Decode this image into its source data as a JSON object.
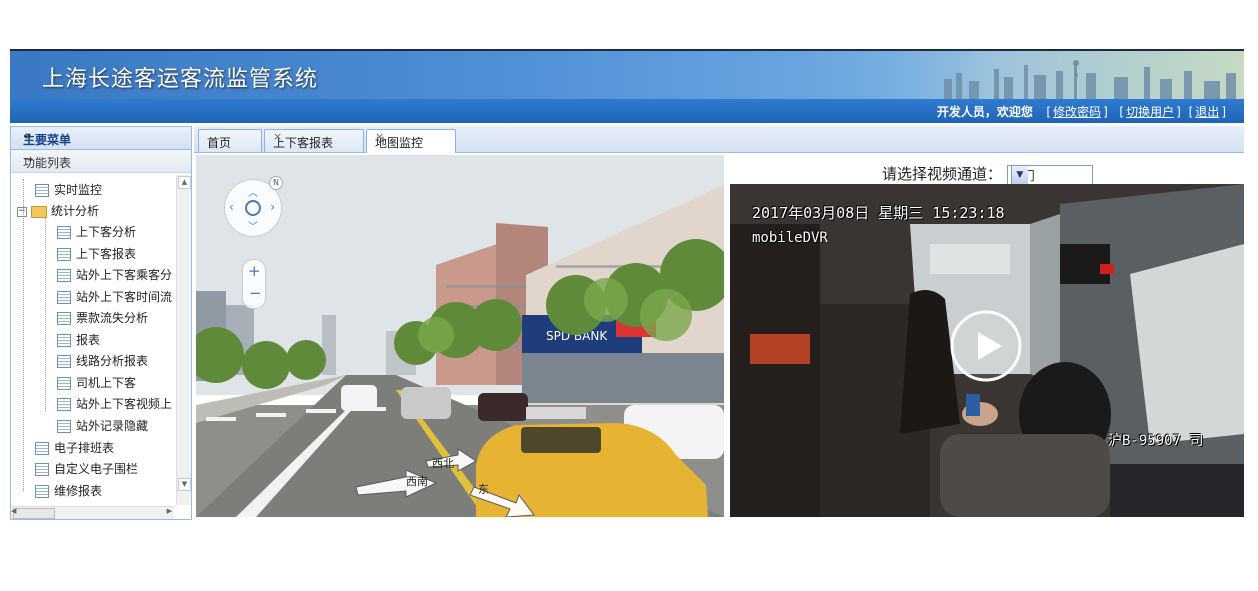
{
  "app": {
    "title": "上海长途客运客流监管系统"
  },
  "userbar": {
    "greeting": "开发人员，欢迎您",
    "links": [
      "修改密码",
      "切换用户",
      "退出"
    ]
  },
  "sidebar": {
    "header": "主要菜单",
    "collapse_glyph": "«",
    "section": "功能列表",
    "section_toggle": "−",
    "items": [
      {
        "label": "实时监控",
        "level": 1,
        "type": "leaf"
      },
      {
        "label": "统计分析",
        "level": 1,
        "type": "folder",
        "expanded": true
      },
      {
        "label": "上下客分析",
        "level": 2,
        "type": "leaf"
      },
      {
        "label": "上下客报表",
        "level": 2,
        "type": "leaf"
      },
      {
        "label": "站外上下客乘客分",
        "level": 2,
        "type": "leaf"
      },
      {
        "label": "站外上下客时间流",
        "level": 2,
        "type": "leaf"
      },
      {
        "label": "票款流失分析",
        "level": 2,
        "type": "leaf"
      },
      {
        "label": "报表",
        "level": 2,
        "type": "leaf"
      },
      {
        "label": "线路分析报表",
        "level": 2,
        "type": "leaf"
      },
      {
        "label": "司机上下客",
        "level": 2,
        "type": "leaf"
      },
      {
        "label": "站外上下客视频上",
        "level": 2,
        "type": "leaf"
      },
      {
        "label": "站外记录隐藏",
        "level": 2,
        "type": "leaf"
      },
      {
        "label": "电子排班表",
        "level": 1,
        "type": "leaf"
      },
      {
        "label": "自定义电子围栏",
        "level": 1,
        "type": "leaf"
      },
      {
        "label": "维修报表",
        "level": 1,
        "type": "leaf"
      }
    ]
  },
  "tabs": [
    {
      "label": "首页",
      "closable": false,
      "active": false
    },
    {
      "label": "上下客报表",
      "closable": true,
      "active": false
    },
    {
      "label": "地图监控",
      "closable": true,
      "active": true
    }
  ],
  "streetview": {
    "compass": "N",
    "zoom_in": "+",
    "zoom_out": "−",
    "road_labels": [
      "西北",
      "西南",
      "东"
    ],
    "bank_sign": "SPD BANK"
  },
  "video": {
    "channel_label": "请选择视频通道：",
    "channel_value": "前门",
    "timestamp": "2017年03月08日 星期三 15:23:18",
    "device": "mobileDVR",
    "plate": "沪B-95907 司"
  }
}
